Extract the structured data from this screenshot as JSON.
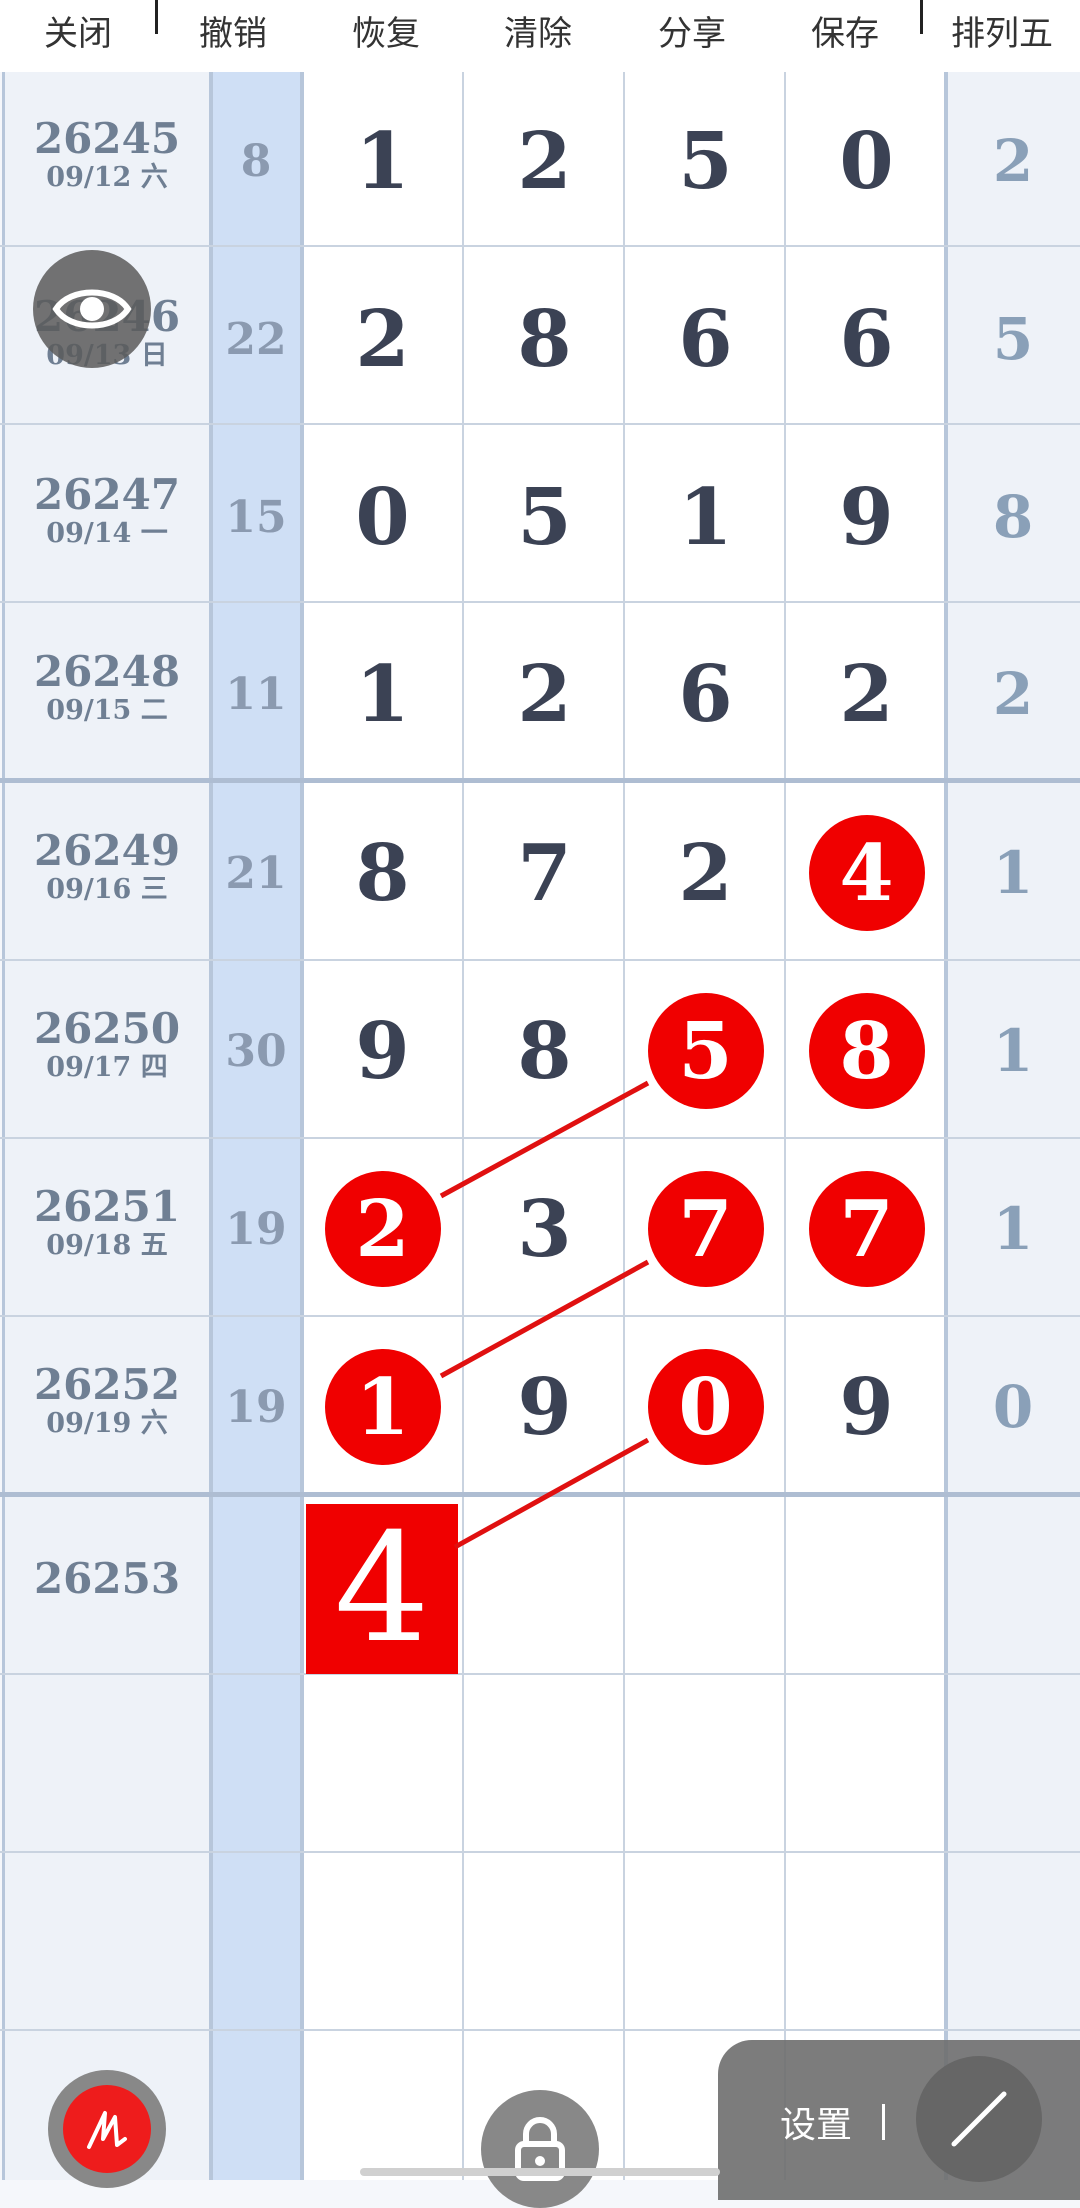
{
  "toolbar": {
    "close": "关闭",
    "undo": "撤销",
    "redo": "恢复",
    "clear": "清除",
    "share": "分享",
    "save": "保存",
    "game": "排列五"
  },
  "rows": [
    {
      "issue": "26245",
      "date": "09/12 六",
      "sum": "8",
      "d1": "1",
      "d2": "2",
      "d3": "5",
      "d4": "0",
      "d5": "2"
    },
    {
      "issue": "26246",
      "date": "09/13 日",
      "sum": "22",
      "d1": "2",
      "d2": "8",
      "d3": "6",
      "d4": "6",
      "d5": "5"
    },
    {
      "issue": "26247",
      "date": "09/14 一",
      "sum": "15",
      "d1": "0",
      "d2": "5",
      "d3": "1",
      "d4": "9",
      "d5": "8"
    },
    {
      "issue": "26248",
      "date": "09/15 二",
      "sum": "11",
      "d1": "1",
      "d2": "2",
      "d3": "6",
      "d4": "2",
      "d5": "2"
    },
    {
      "issue": "26249",
      "date": "09/16 三",
      "sum": "21",
      "d1": "8",
      "d2": "7",
      "d3": "2",
      "d4": "4",
      "d5": "1"
    },
    {
      "issue": "26250",
      "date": "09/17 四",
      "sum": "30",
      "d1": "9",
      "d2": "8",
      "d3": "5",
      "d4": "8",
      "d5": "1"
    },
    {
      "issue": "26251",
      "date": "09/18 五",
      "sum": "19",
      "d1": "2",
      "d2": "3",
      "d3": "7",
      "d4": "7",
      "d5": "1"
    },
    {
      "issue": "26252",
      "date": "09/19 六",
      "sum": "19",
      "d1": "1",
      "d2": "9",
      "d3": "0",
      "d4": "9",
      "d5": "0"
    }
  ],
  "next": {
    "issue": "26253",
    "prediction": "4"
  },
  "highlights": [
    "r4d4",
    "r5d3",
    "r5d4",
    "r6d1",
    "r6d3",
    "r6d4",
    "r7d1",
    "r7d3"
  ],
  "bottom": {
    "settings_label": "设置"
  },
  "icons": [
    "eye-icon",
    "pen-icon",
    "lock-icon",
    "line-tool-icon"
  ],
  "colors": {
    "accent": "#f00000",
    "sum_column": "#cfdff5",
    "text": "#3b4254"
  }
}
